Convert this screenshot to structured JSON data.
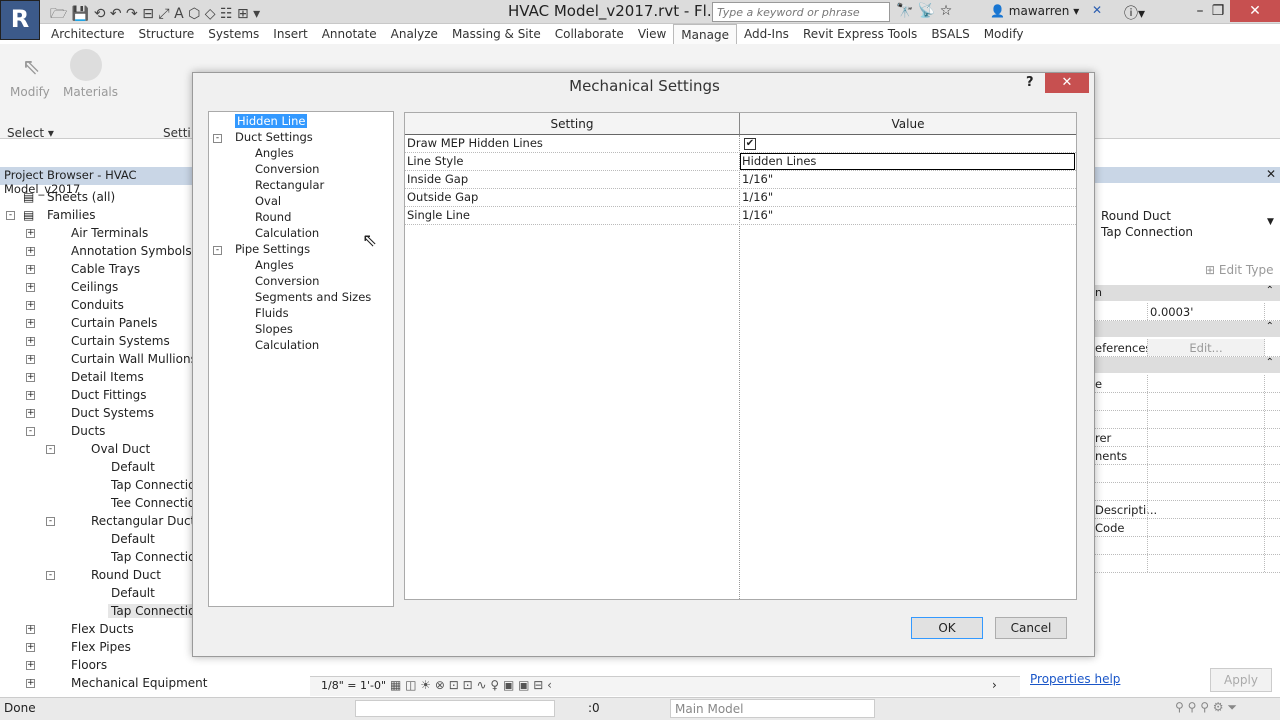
{
  "app": {
    "logo": "R",
    "document_title": "HVAC Model_v2017.rvt - Fl...",
    "search_placeholder": "Type a keyword or phrase",
    "user": "mawarren"
  },
  "ribbon": {
    "tabs": [
      "Architecture",
      "Structure",
      "Systems",
      "Insert",
      "Annotate",
      "Analyze",
      "Massing & Site",
      "Collaborate",
      "View",
      "Manage",
      "Add-Ins",
      "Revit Express Tools",
      "BSALS",
      "Modify"
    ],
    "active_tab": "Manage",
    "modify_label": "Modify",
    "materials_label": "Materials",
    "select_label": "Select ▾",
    "settings_label": "Setti"
  },
  "project_browser": {
    "title": "Project Browser - HVAC Model_v2017",
    "items": [
      {
        "label": "Sheets (all)",
        "level": 0,
        "toggle": ""
      },
      {
        "label": "Families",
        "level": 0,
        "toggle": "-"
      },
      {
        "label": "Air Terminals",
        "level": 1,
        "toggle": "+"
      },
      {
        "label": "Annotation Symbols",
        "level": 1,
        "toggle": "+"
      },
      {
        "label": "Cable Trays",
        "level": 1,
        "toggle": "+"
      },
      {
        "label": "Ceilings",
        "level": 1,
        "toggle": "+"
      },
      {
        "label": "Conduits",
        "level": 1,
        "toggle": "+"
      },
      {
        "label": "Curtain Panels",
        "level": 1,
        "toggle": "+"
      },
      {
        "label": "Curtain Systems",
        "level": 1,
        "toggle": "+"
      },
      {
        "label": "Curtain Wall Mullions",
        "level": 1,
        "toggle": "+"
      },
      {
        "label": "Detail Items",
        "level": 1,
        "toggle": "+"
      },
      {
        "label": "Duct Fittings",
        "level": 1,
        "toggle": "+"
      },
      {
        "label": "Duct Systems",
        "level": 1,
        "toggle": "+"
      },
      {
        "label": "Ducts",
        "level": 1,
        "toggle": "-"
      },
      {
        "label": "Oval Duct",
        "level": 2,
        "toggle": "-"
      },
      {
        "label": "Default",
        "level": 3,
        "toggle": ""
      },
      {
        "label": "Tap Connection",
        "level": 3,
        "toggle": ""
      },
      {
        "label": "Tee Connection",
        "level": 3,
        "toggle": ""
      },
      {
        "label": "Rectangular Duct",
        "level": 2,
        "toggle": "-"
      },
      {
        "label": "Default",
        "level": 3,
        "toggle": ""
      },
      {
        "label": "Tap Connection",
        "level": 3,
        "toggle": ""
      },
      {
        "label": "Round Duct",
        "level": 2,
        "toggle": "-"
      },
      {
        "label": "Default",
        "level": 3,
        "toggle": ""
      },
      {
        "label": "Tap Connection",
        "level": 3,
        "toggle": "",
        "selected": true
      },
      {
        "label": "Flex Ducts",
        "level": 1,
        "toggle": "+"
      },
      {
        "label": "Flex Pipes",
        "level": 1,
        "toggle": "+"
      },
      {
        "label": "Floors",
        "level": 1,
        "toggle": "+"
      },
      {
        "label": "Mechanical Equipment",
        "level": 1,
        "toggle": "+"
      }
    ]
  },
  "properties": {
    "type_line1": "Round Duct",
    "type_line2": "Tap Connection",
    "edit_type": "Edit Type",
    "rows": [
      {
        "type": "head",
        "label": "n"
      },
      {
        "label": "",
        "value": "0.0003'"
      },
      {
        "type": "head",
        "label": ""
      },
      {
        "label": "eferences",
        "value": "Edit..."
      },
      {
        "type": "head",
        "label": ""
      },
      {
        "label": "e",
        "value": ""
      },
      {
        "label": "",
        "value": ""
      },
      {
        "label": "",
        "value": ""
      },
      {
        "label": "rer",
        "value": ""
      },
      {
        "label": "nents",
        "value": ""
      },
      {
        "label": "",
        "value": ""
      },
      {
        "label": "",
        "value": ""
      },
      {
        "label": "Descripti...",
        "value": ""
      },
      {
        "label": "Code",
        "value": ""
      },
      {
        "label": "",
        "value": ""
      },
      {
        "label": "",
        "value": ""
      }
    ],
    "help_link": "Properties help",
    "apply": "Apply"
  },
  "view_bar": {
    "scale": "1/8\" = 1'-0\""
  },
  "status_bar": {
    "text": "Done",
    "count": ":0",
    "workset": "Main Model"
  },
  "dialog": {
    "title": "Mechanical Settings",
    "help": "?",
    "close": "✕",
    "tree": [
      {
        "label": "Hidden Line",
        "level": 0,
        "selected": true
      },
      {
        "label": "Duct Settings",
        "level": 0,
        "toggle": "-"
      },
      {
        "label": "Angles",
        "level": 1
      },
      {
        "label": "Conversion",
        "level": 1
      },
      {
        "label": "Rectangular",
        "level": 1
      },
      {
        "label": "Oval",
        "level": 1
      },
      {
        "label": "Round",
        "level": 1
      },
      {
        "label": "Calculation",
        "level": 1
      },
      {
        "label": "Pipe Settings",
        "level": 0,
        "toggle": "-"
      },
      {
        "label": "Angles",
        "level": 1
      },
      {
        "label": "Conversion",
        "level": 1
      },
      {
        "label": "Segments and Sizes",
        "level": 1
      },
      {
        "label": "Fluids",
        "level": 1
      },
      {
        "label": "Slopes",
        "level": 1
      },
      {
        "label": "Calculation",
        "level": 1
      }
    ],
    "columns": [
      "Setting",
      "Value"
    ],
    "rows": [
      {
        "setting": "Draw MEP Hidden Lines",
        "value": "",
        "checkbox": true,
        "checked": true
      },
      {
        "setting": "Line Style",
        "value": "Hidden Lines",
        "editing": true
      },
      {
        "setting": "Inside Gap",
        "value": "1/16\""
      },
      {
        "setting": "Outside Gap",
        "value": "1/16\""
      },
      {
        "setting": "Single Line",
        "value": "1/16\""
      }
    ],
    "ok": "OK",
    "cancel": "Cancel"
  }
}
